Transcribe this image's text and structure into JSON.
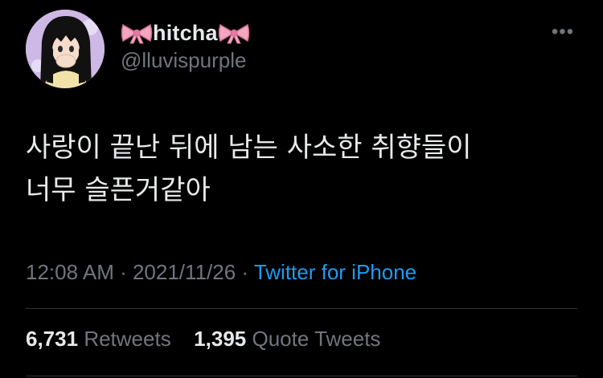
{
  "tweet": {
    "author": {
      "display_name": "hitcha",
      "name_emoji": "ribbon-icon",
      "handle": "@lluvispurple"
    },
    "more_label": "•••",
    "text_line1": "사랑이 끝난 뒤에 남는 사소한 취향들이",
    "text_line2": "너무 슬픈거같아",
    "time": "12:08 AM",
    "date": "2021/11/26",
    "separator": " · ",
    "source": "Twitter for iPhone",
    "retweets_count": "6,731",
    "retweets_label": "Retweets",
    "quotes_count": "1,395",
    "quotes_label": "Quote Tweets"
  },
  "colors": {
    "background": "#000000",
    "text_primary": "#e7e9ea",
    "text_secondary": "#71767b",
    "link": "#1d9bf0",
    "divider": "#2f3336",
    "ribbon": "#f4a6c0"
  }
}
